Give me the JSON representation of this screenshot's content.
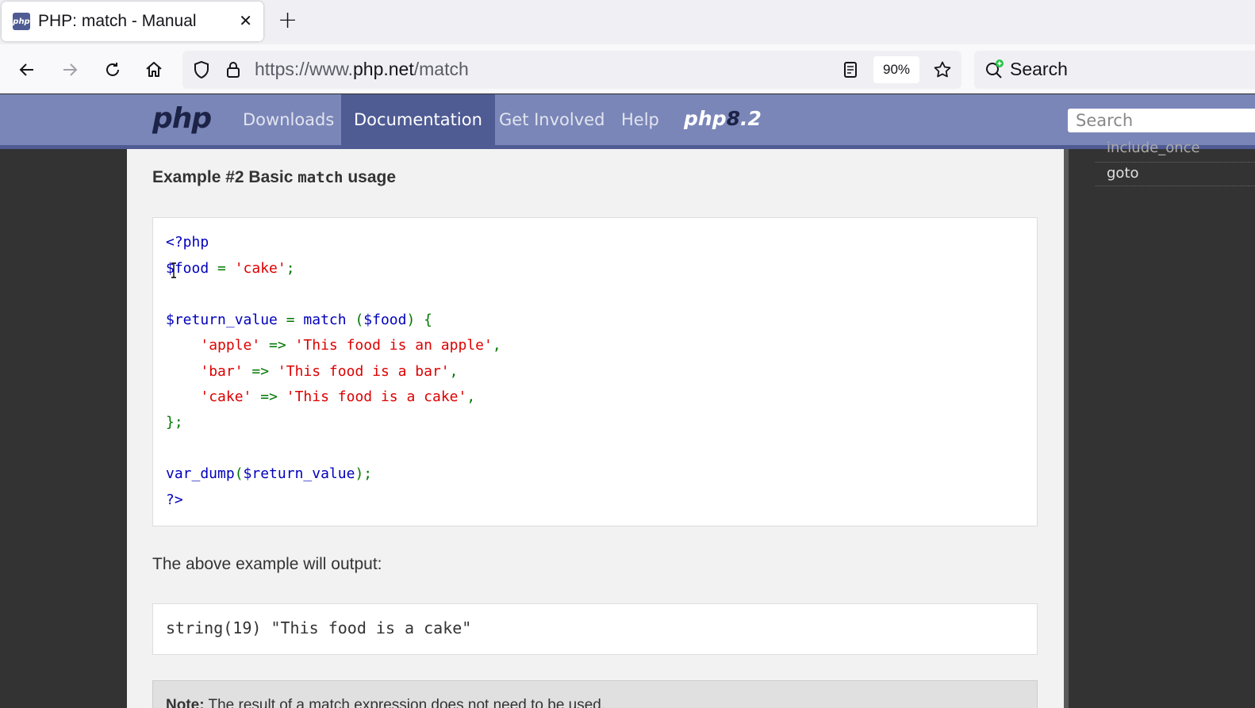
{
  "browser": {
    "tab": {
      "favicon_text": "php",
      "title": "PHP: match - Manual",
      "close_glyph": "✕"
    },
    "new_tab_glyph": "+",
    "url": {
      "prefix": "https://www.",
      "host": "php.net",
      "path": "/match"
    },
    "zoom": "90%",
    "search_label": "Search"
  },
  "site": {
    "logo": "php",
    "nav": [
      {
        "label": "Downloads",
        "active": false
      },
      {
        "label": "Documentation",
        "active": true
      },
      {
        "label": "Get Involved",
        "active": false
      },
      {
        "label": "Help",
        "active": false
      }
    ],
    "release_badge": {
      "pre": "php",
      "amp": "8",
      "post": ".2"
    },
    "search_placeholder": "Search"
  },
  "sidebar": {
    "items": [
      "include_once",
      "goto"
    ]
  },
  "example": {
    "title_pre": "Example #2 Basic ",
    "title_code": "match",
    "title_post": " usage",
    "code": {
      "l1": "<?php",
      "l2_var": "$food",
      "l2_op": " = ",
      "l2_str": "'cake'",
      "l2_end": ";",
      "l4_var": "$return_value",
      "l4_op": " = ",
      "l4_kw": "match ",
      "l4_paren_open": "(",
      "l4_arg": "$food",
      "l4_paren_close": ") {",
      "l5_key": "'apple'",
      "l5_arrow": " => ",
      "l5_val": "'This food is an apple'",
      "l5_comma": ",",
      "l6_key": "'bar'",
      "l6_arrow": " => ",
      "l6_val": "'This food is a bar'",
      "l6_comma": ",",
      "l7_key": "'cake'",
      "l7_arrow": " => ",
      "l7_val": "'This food is a cake'",
      "l7_comma": ",",
      "l8": "};",
      "l10_fn": "var_dump",
      "l10_open": "(",
      "l10_arg": "$return_value",
      "l10_close": ");",
      "l11": "?>"
    },
    "output_label": "The above example will output:",
    "output": "string(19) \"This food is a cake\"",
    "note_label": "Note:",
    "note_text": "The result of a match expression does not need to be used."
  }
}
